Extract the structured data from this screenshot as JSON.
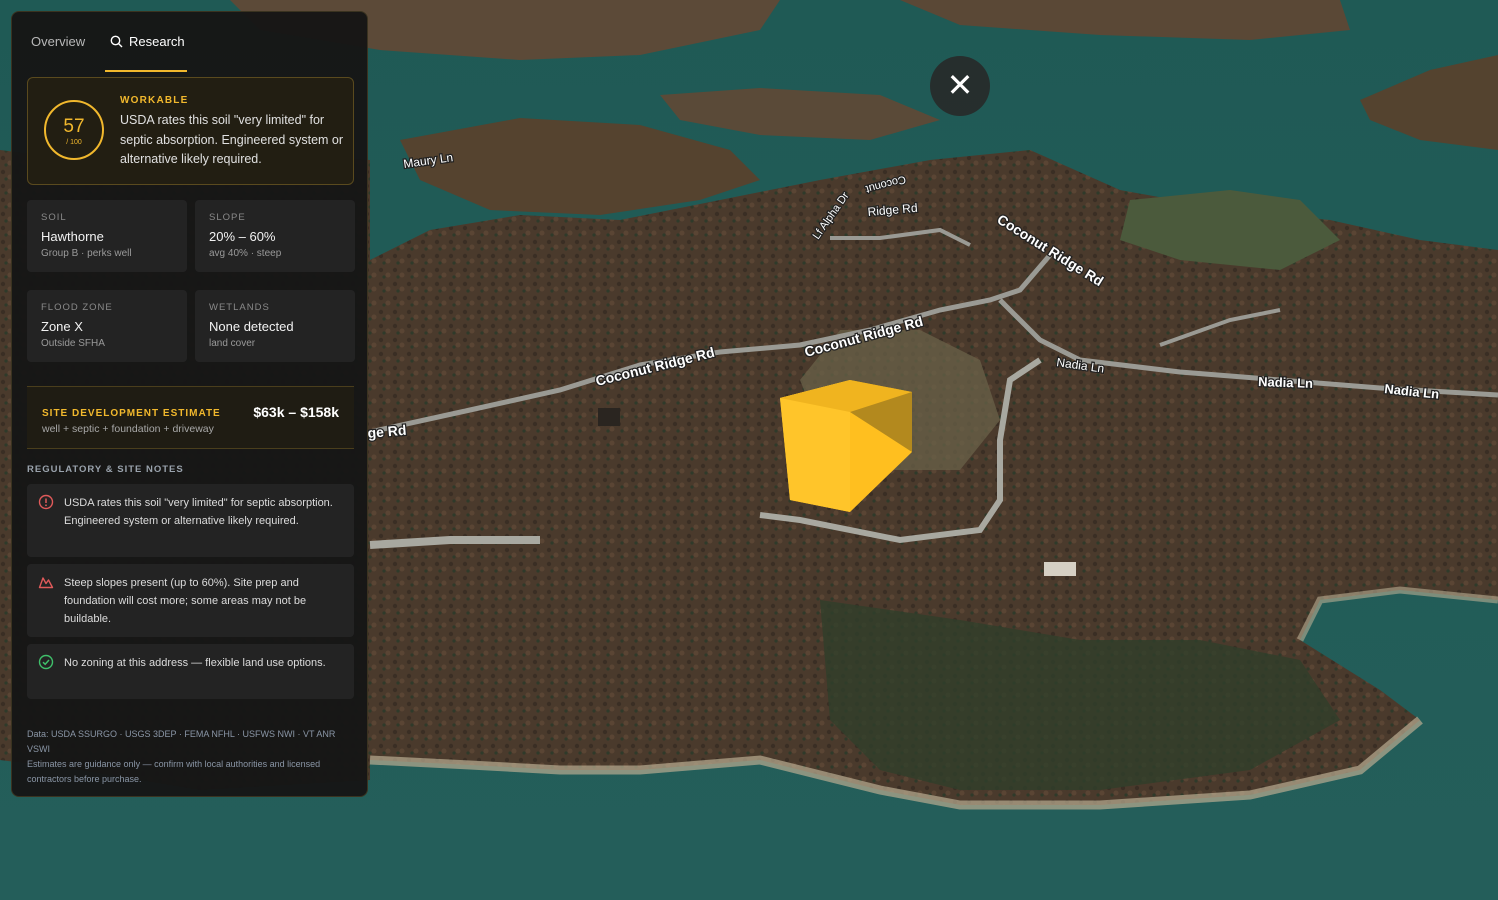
{
  "tabs": {
    "overview": "Overview",
    "research": "Research"
  },
  "score": {
    "value": "57",
    "out_of": "/ 100",
    "status": "WORKABLE",
    "description": "USDA rates this soil \"very limited\" for septic absorption. Engineered system or alternative likely required."
  },
  "stats": {
    "soil": {
      "label": "SOIL",
      "value": "Hawthorne",
      "sub": "Group B · perks well"
    },
    "slope": {
      "label": "SLOPE",
      "value": "20% – 60%",
      "sub": "avg 40% · steep"
    },
    "flood": {
      "label": "FLOOD ZONE",
      "value": "Zone X",
      "sub": "Outside SFHA"
    },
    "wetlands": {
      "label": "WETLANDS",
      "value": "None detected",
      "sub": "land cover"
    }
  },
  "estimate": {
    "title": "SITE DEVELOPMENT ESTIMATE",
    "range": "$63k – $158k",
    "sub": "well + septic + foundation + driveway"
  },
  "notes": {
    "title": "REGULATORY & SITE NOTES",
    "items": [
      {
        "icon": "alert-circle-icon",
        "text": "USDA rates this soil \"very limited\" for septic absorption. Engineered system or alternative likely required."
      },
      {
        "icon": "mountain-icon",
        "text": "Steep slopes present (up to 60%). Site prep and foundation will cost more; some areas may not be buildable."
      },
      {
        "icon": "check-circle-icon",
        "text": "No zoning at this address — flexible land use options."
      }
    ]
  },
  "footer": {
    "sources": "Data: USDA SSURGO · USGS 3DEP · FEMA NFHL · USFWS NWI · VT ANR VSWI",
    "disclaimer": "Estimates are guidance only — confirm with local authorities and licensed contractors before purchase."
  },
  "map": {
    "road_labels": {
      "maury": "Maury Ln",
      "coconut_main": "Coconut Ridge Rd",
      "coconut_mid": "Coconut Ridge Rd",
      "coconut_upper": "Coconut Ridge Rd",
      "coconut_partial": "Coconut",
      "ridge_partial": "Ridge Rd",
      "ge_rd": "ge Rd",
      "lf_dr": "Lf Alpha Dr",
      "nadia_1": "Nadia Ln",
      "nadia_2": "Nadia Ln",
      "nadia_3": "Nadia Ln"
    }
  },
  "colors": {
    "accent": "#f1b82d",
    "danger": "#e05a5a",
    "success": "#3fbf6a",
    "water": "#1f5450"
  },
  "close_icon": "close-icon"
}
